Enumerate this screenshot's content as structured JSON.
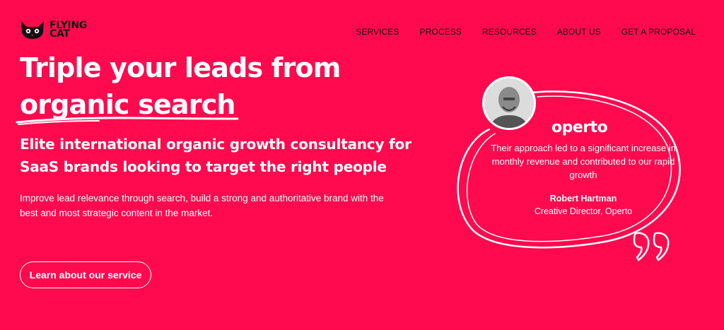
{
  "brand": {
    "line1": "FLYING",
    "line2": "CAT"
  },
  "nav": {
    "items": [
      "SERVICES",
      "PROCESS",
      "RESOURCES",
      "ABOUT US",
      "GET A PROPOSAL"
    ]
  },
  "hero": {
    "headline_line1": "Triple your leads from",
    "headline_line2": "organic search",
    "subheadline": "Elite international organic growth consultancy for SaaS brands looking to target the right people",
    "description": "Improve lead relevance through search, build a strong and authoritative brand with the best and most strategic content in the market.",
    "cta_label": "Learn about our service"
  },
  "testimonial": {
    "company": "operto",
    "quote": "Their approach led to a significant increase in monthly revenue and contributed to our rapid growth",
    "author": "Robert Hartman",
    "role": "Creative Director, Operto"
  },
  "colors": {
    "background": "#ff0a4e",
    "text": "#ffffff",
    "nav": "#111111"
  },
  "icons": {
    "logo": "cat-logo-icon",
    "quote": "quote-mark-icon"
  }
}
